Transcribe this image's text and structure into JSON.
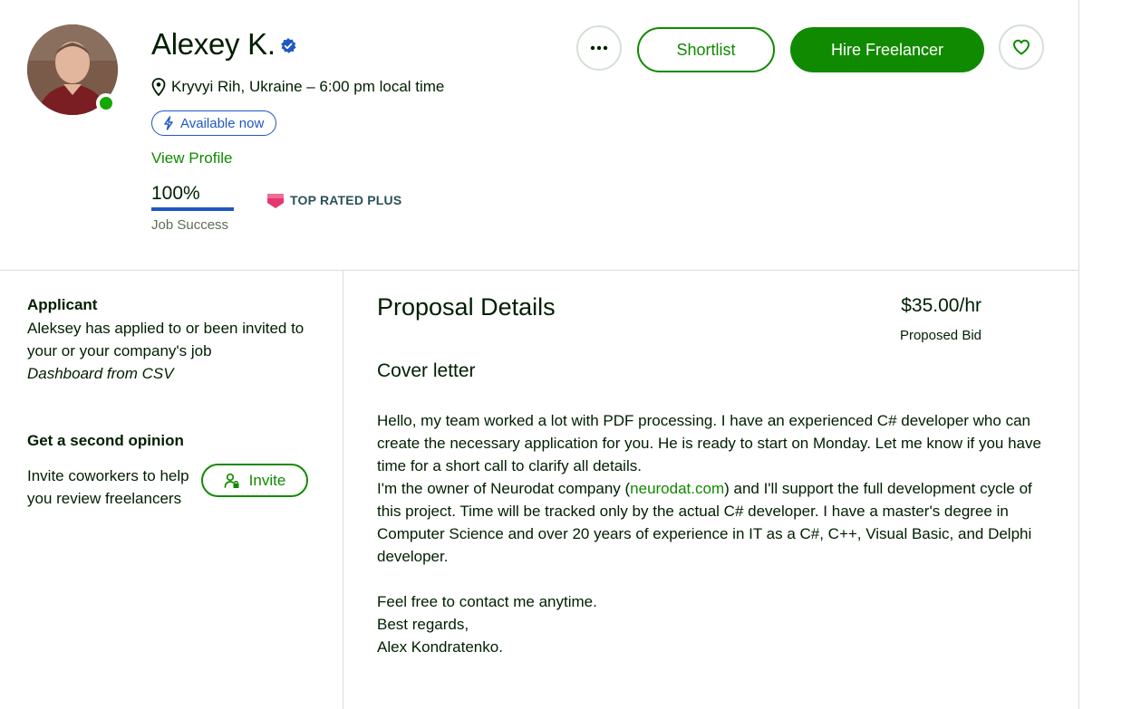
{
  "freelancer": {
    "name": "Alexey K.",
    "location": "Kryvyi Rih, Ukraine – 6:00 pm local time",
    "availability": "Available now",
    "view_profile": "View Profile",
    "job_success_value": "100%",
    "job_success_label": "Job Success",
    "job_success_fraction": 1.0,
    "badge": "TOP RATED PLUS",
    "online": true
  },
  "actions": {
    "more_icon": "ellipsis-icon",
    "shortlist": "Shortlist",
    "hire": "Hire Freelancer",
    "heart_icon": "heart-icon"
  },
  "sidebar": {
    "applicant_heading": "Applicant",
    "applicant_text": "Aleksey has applied to or been invited to your or your company's job",
    "applicant_job": "Dashboard from CSV",
    "opinion_heading": "Get a second opinion",
    "opinion_text": "Invite coworkers to help you review freelancers",
    "invite": "Invite"
  },
  "proposal": {
    "heading": "Proposal Details",
    "rate": "$35.00/hr",
    "rate_label": "Proposed Bid",
    "cover_heading": "Cover letter",
    "cover_p1": "Hello, my team worked a lot with PDF processing. I have an experienced C# developer who can create the necessary application for you. He is ready to start on Monday. Let me know if you have time for a short call to clarify all details.",
    "cover_p2_before": "I'm the owner of Neurodat company (",
    "cover_p2_link": "neurodat.com",
    "cover_p2_after": ") and I'll support the full development cycle of this project. Time will be tracked only by the actual C# developer. I have a master's degree in Computer Science and over 20 years of experience in IT as a C#, C++, Visual Basic, and Delphi developer.",
    "cover_p3": "Feel free to contact me anytime.",
    "cover_p4": "Best regards,",
    "cover_p5": "Alex Kondratenko."
  },
  "colors": {
    "brand_green": "#108a00",
    "blue": "#1f57c3",
    "text": "#001e00",
    "muted": "#5e6d55",
    "border": "#d5e0d5",
    "badge_pink": "#e3386e"
  }
}
